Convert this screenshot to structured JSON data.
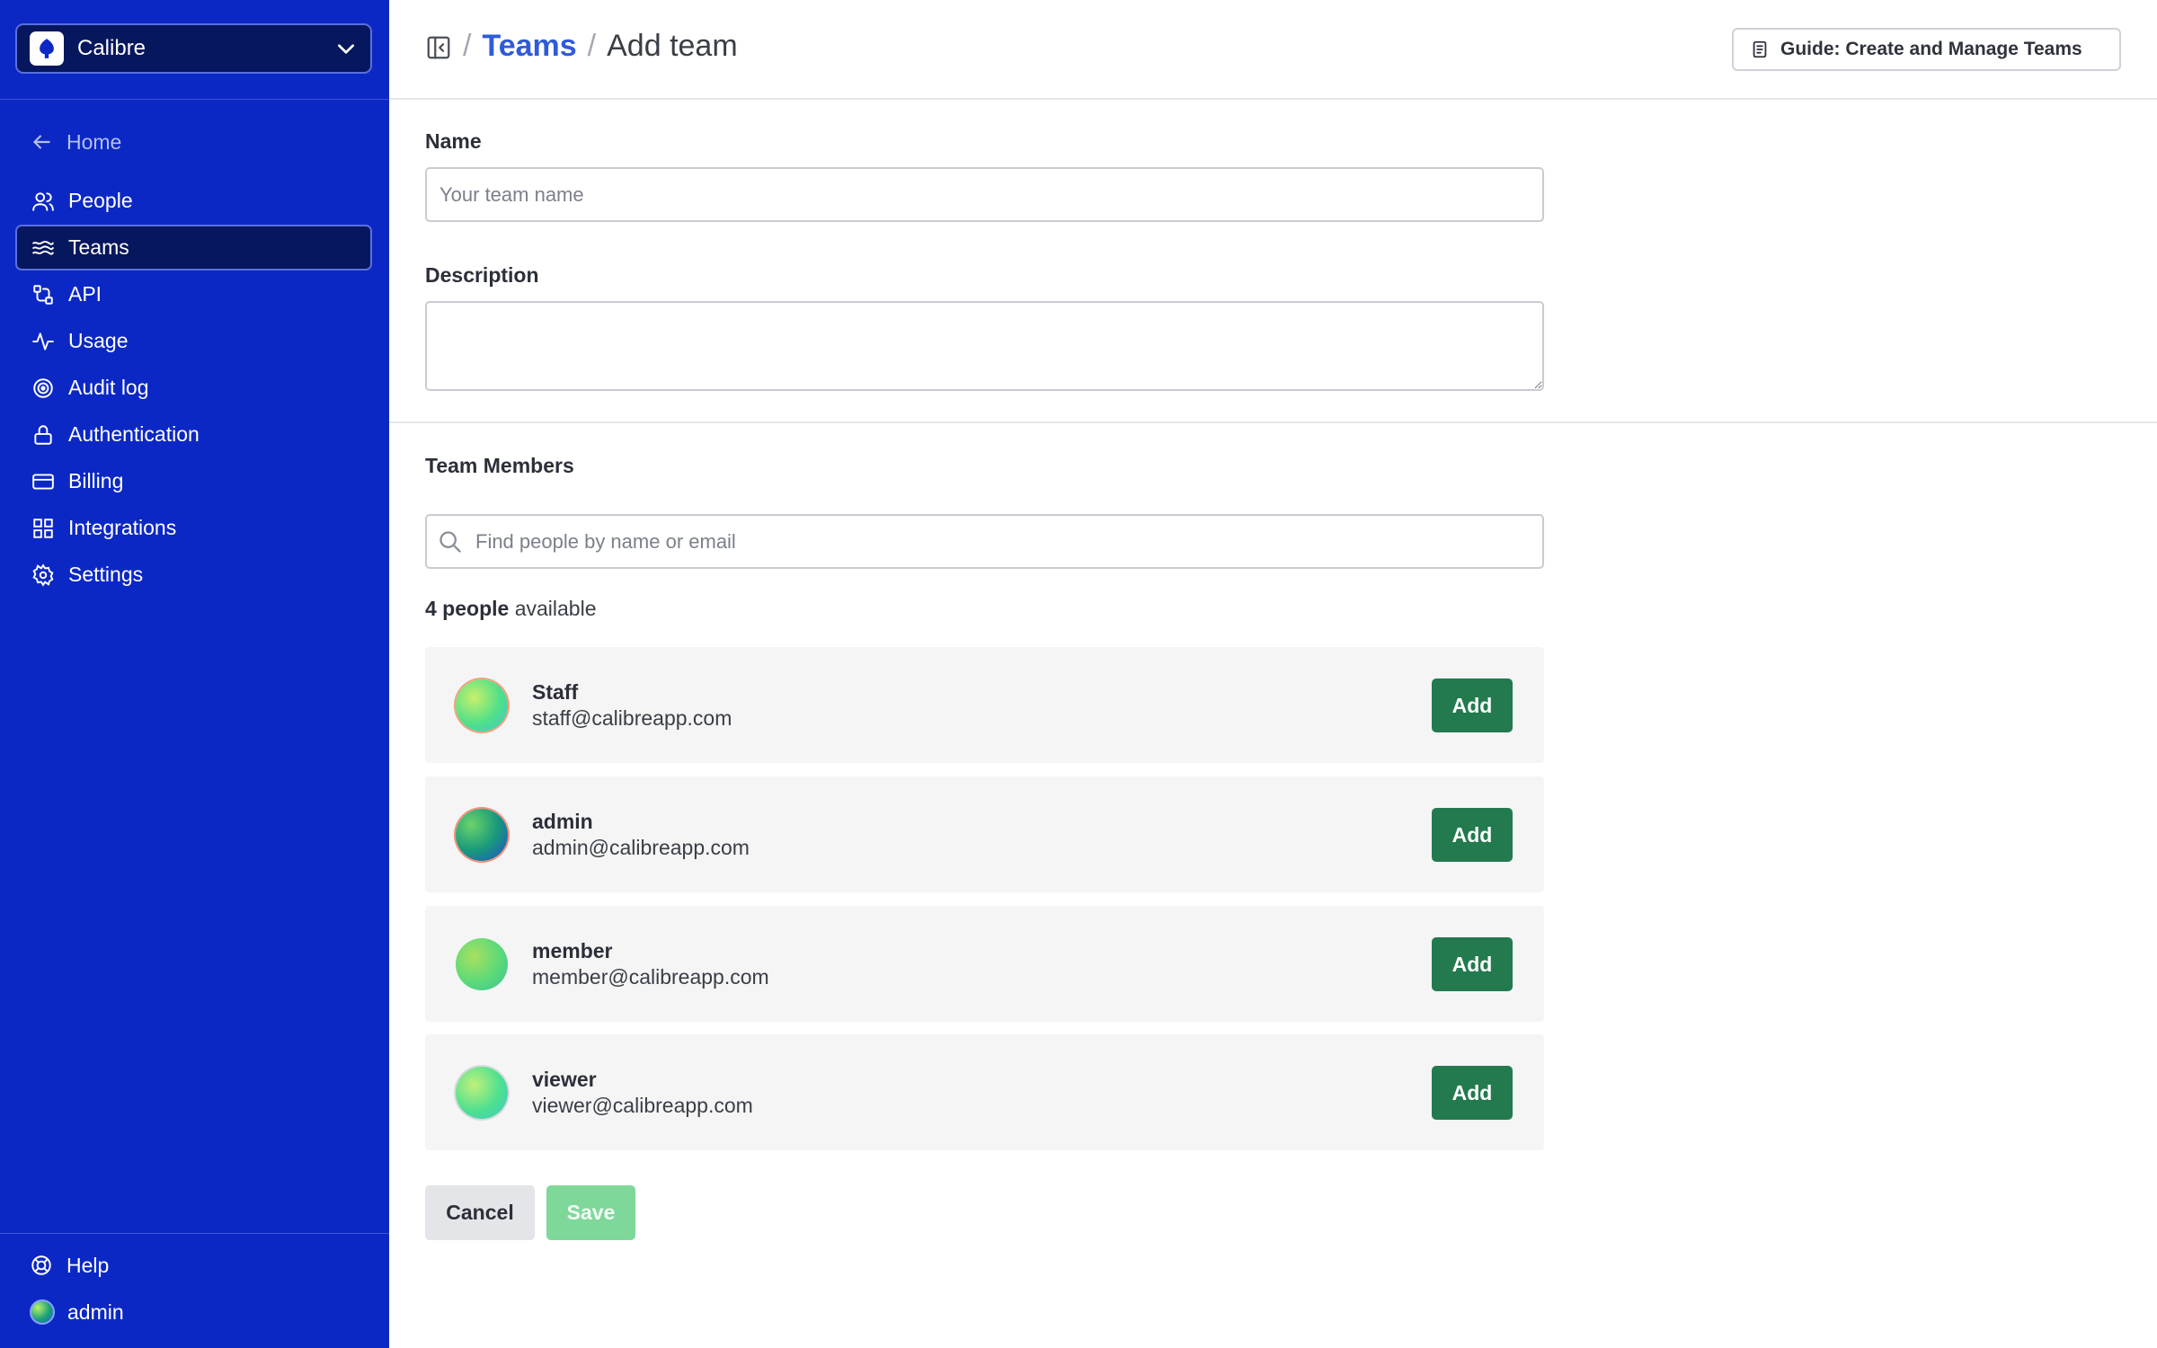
{
  "org": {
    "name": "Calibre"
  },
  "nav": {
    "home": "Home",
    "items": [
      {
        "label": "People",
        "icon": "people-icon"
      },
      {
        "label": "Teams",
        "icon": "teams-icon",
        "active": true
      },
      {
        "label": "API",
        "icon": "api-icon"
      },
      {
        "label": "Usage",
        "icon": "activity-icon"
      },
      {
        "label": "Audit log",
        "icon": "audit-icon"
      },
      {
        "label": "Authentication",
        "icon": "lock-icon"
      },
      {
        "label": "Billing",
        "icon": "credit-card-icon"
      },
      {
        "label": "Integrations",
        "icon": "integrations-icon"
      },
      {
        "label": "Settings",
        "icon": "gear-icon"
      }
    ],
    "help": "Help",
    "user": "admin"
  },
  "header": {
    "breadcrumb_parent": "Teams",
    "breadcrumb_current": "Add team",
    "separator": "/",
    "guide_label": "Guide: Create and Manage Teams"
  },
  "form": {
    "name_label": "Name",
    "name_placeholder": "Your team name",
    "name_value": "",
    "description_label": "Description",
    "description_value": "",
    "members_label": "Team Members",
    "search_placeholder": "Find people by name or email",
    "available_count": "4 people",
    "available_suffix": " available"
  },
  "members": [
    {
      "name": "Staff",
      "email": "staff@calibreapp.com",
      "add_label": "Add"
    },
    {
      "name": "admin",
      "email": "admin@calibreapp.com",
      "add_label": "Add"
    },
    {
      "name": "member",
      "email": "member@calibreapp.com",
      "add_label": "Add"
    },
    {
      "name": "viewer",
      "email": "viewer@calibreapp.com",
      "add_label": "Add"
    }
  ],
  "actions": {
    "cancel": "Cancel",
    "save": "Save"
  },
  "colors": {
    "sidebar_bg": "#0c28c4",
    "sidebar_active": "#07175e",
    "link": "#2f5bd8",
    "add_button": "#237a4f",
    "save_disabled": "#7ed89a"
  }
}
